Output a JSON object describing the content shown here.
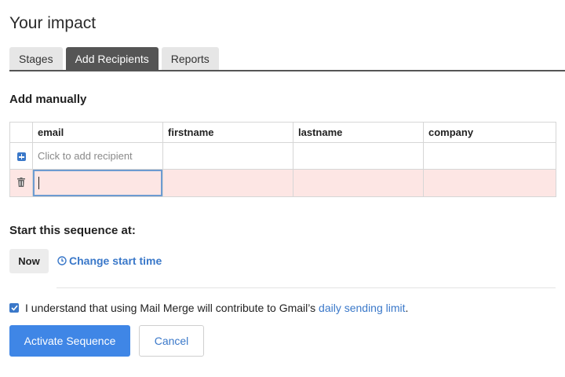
{
  "page": {
    "title": "Your impact"
  },
  "tabs": [
    {
      "label": "Stages",
      "active": false
    },
    {
      "label": "Add Recipients",
      "active": true
    },
    {
      "label": "Reports",
      "active": false
    }
  ],
  "add_manually": {
    "heading": "Add manually",
    "columns": [
      "email",
      "firstname",
      "lastname",
      "company"
    ],
    "add_row_placeholder": "Click to add recipient",
    "icons": {
      "add": "plus-square-icon",
      "delete": "trash-icon"
    }
  },
  "sequence": {
    "heading": "Start this sequence at:",
    "now_label": "Now",
    "change_start_label": "Change start time",
    "change_start_icon": "clock-icon"
  },
  "consent": {
    "checked": true,
    "text": "I understand that using Mail Merge will contribute to Gmail’s ",
    "link_text": "daily sending limit",
    "suffix": "."
  },
  "actions": {
    "activate_label": "Activate Sequence",
    "cancel_label": "Cancel"
  },
  "colors": {
    "accent": "#3a78c9",
    "primary_button": "#3f86e6",
    "active_tab": "#555555",
    "error_row": "#fde6e4"
  }
}
